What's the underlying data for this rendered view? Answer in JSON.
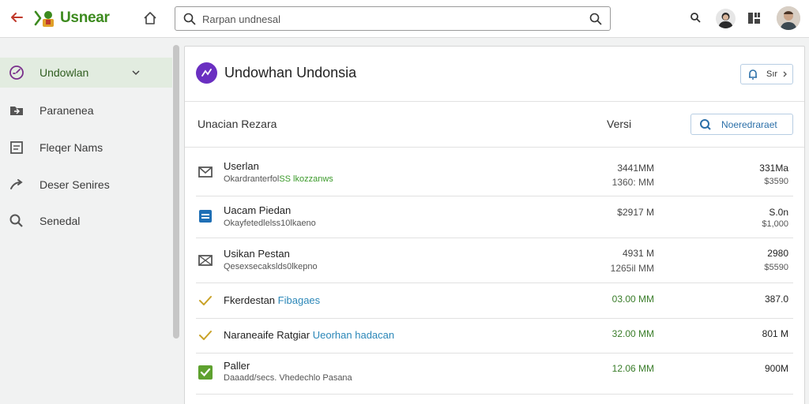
{
  "app": {
    "title": "Usnear"
  },
  "search": {
    "placeholder": "Rarpan undnesal"
  },
  "sidebar": {
    "items": [
      {
        "label": "Undowlan",
        "icon": "gauge-icon",
        "active": true
      },
      {
        "label": "Paranenea",
        "icon": "folder-icon"
      },
      {
        "label": "Fleqer Nams",
        "icon": "file-icon"
      },
      {
        "label": "Deser Senires",
        "icon": "arrow-icon"
      },
      {
        "label": "Senedal",
        "icon": "search-icon"
      }
    ]
  },
  "card": {
    "title": "Undowhan Undonsia",
    "share_label": "Sır"
  },
  "table": {
    "name_header": "Unacian Rezara",
    "version_header": "Versi",
    "filter_label": "Noeredraraet",
    "rows": [
      {
        "icon": "mail-icon",
        "name": "Userlan",
        "sub": "Okardranterfol",
        "sub_hl": "SS lkozzanws",
        "v1": "3441MM",
        "v2": "1360: MM",
        "s1": "331Ma",
        "s2": "$3590"
      },
      {
        "icon": "doc-icon",
        "name": "Uacam Piedan",
        "sub": "Okayfetedlelss10lkaeno",
        "v1": "$2917 M",
        "s1": "S.0n",
        "s2": "$1,000"
      },
      {
        "icon": "mail-x-icon",
        "name": "Usikan Pestan",
        "sub": "Qesexsecakslds0lkepno",
        "v1": "4931 M",
        "v2": "1265il MM",
        "s1": "2980",
        "s2": "$5590"
      },
      {
        "icon": "check-icon",
        "name": "Fkerdestan",
        "inline": "Fibagaes",
        "v1": "03.00 MM",
        "s1": "387.0"
      },
      {
        "icon": "check-icon",
        "name": "Naraneaife Ratgiar",
        "inline": "Ueorhan hadacan",
        "v1": "32.00 MM",
        "s1": "801 M"
      },
      {
        "icon": "check-box-icon",
        "name": "Paller",
        "sub": "Daaadd/secs. Vhedechlo Pasana",
        "v1": "12.06 MM",
        "s1": "900M"
      }
    ]
  },
  "colors": {
    "accent": "#3c8a1e",
    "brand": "#6a2fc1",
    "link": "#2b87b8"
  }
}
